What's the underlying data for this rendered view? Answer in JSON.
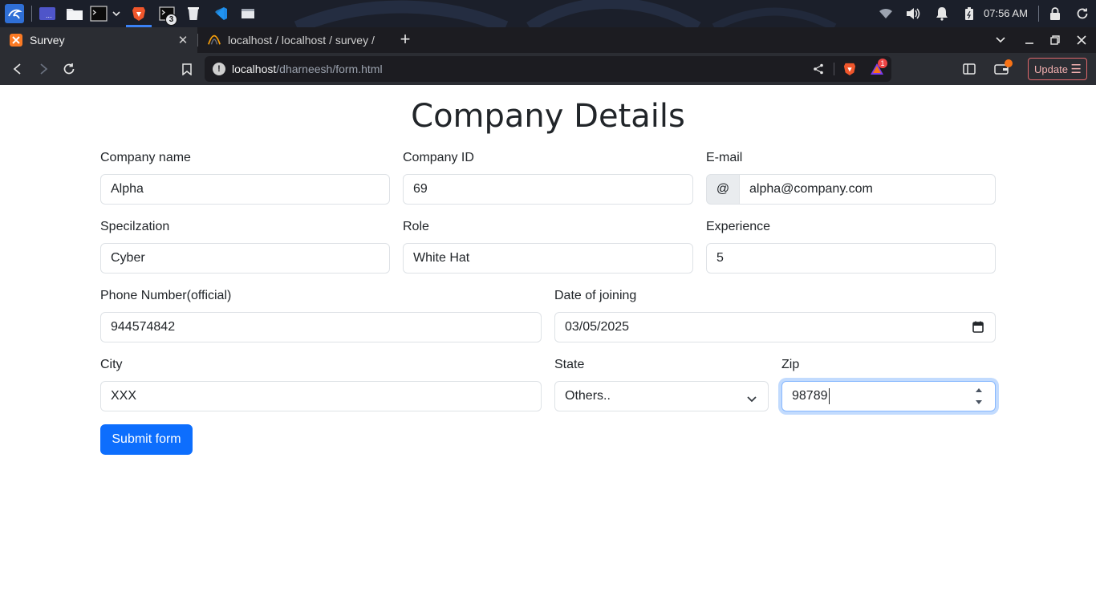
{
  "system": {
    "clock": "07:56 AM",
    "terminal_badge": "3",
    "colors": {
      "taskbar": "#1b1f2a",
      "accent": "#3b82f6"
    },
    "icons": [
      "kali-menu-icon",
      "workspace-icon",
      "file-manager-icon",
      "terminal-icon",
      "brave-icon",
      "terminal-icon",
      "bin-icon",
      "vscode-icon",
      "window-icon",
      "wifi-icon",
      "volume-icon",
      "bell-icon",
      "battery-icon",
      "lock-icon",
      "refresh-icon"
    ]
  },
  "browser": {
    "tabs": [
      {
        "title": "Survey",
        "favicon": "xampp-icon",
        "active": true
      },
      {
        "title": "localhost / localhost / survey / ",
        "favicon": "phpmyadmin-icon",
        "active": false
      }
    ],
    "url_host": "localhost",
    "url_path": "/dharneesh/form.html",
    "update_label": "Update",
    "shields_badge": "1"
  },
  "form": {
    "title": "Company Details",
    "company_name": {
      "label": "Company name",
      "value": "Alpha"
    },
    "company_id": {
      "label": "Company ID",
      "value": "69"
    },
    "email": {
      "label": "E-mail",
      "prefix": "@",
      "value": "alpha@company.com"
    },
    "specialization": {
      "label": "Specilzation",
      "value": "Cyber"
    },
    "role": {
      "label": "Role",
      "value": "White Hat"
    },
    "experience": {
      "label": "Experience",
      "value": "5"
    },
    "phone": {
      "label": "Phone Number(official)",
      "value": "944574842"
    },
    "doj": {
      "label": "Date of joining",
      "value": "03/05/2025"
    },
    "city": {
      "label": "City",
      "value": "XXX"
    },
    "state": {
      "label": "State",
      "value": "Others.."
    },
    "zip": {
      "label": "Zip",
      "value": "98789"
    },
    "submit_label": "Submit form",
    "colors": {
      "primary": "#0d6efd",
      "border": "#dee2e6",
      "focus": "#86b7fe"
    }
  }
}
